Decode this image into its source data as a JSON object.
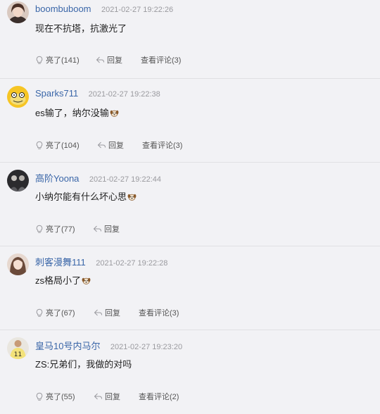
{
  "comments": [
    {
      "username": "boombuboom",
      "timestamp": "2021-02-27 19:22:26",
      "text": "现在不抗塔，抗激光了",
      "has_emoji": false,
      "like_label": "亮了(141)",
      "reply_label": "回复",
      "view_label": "查看评论(3)",
      "avatar_icon": "photo-avatar-woman-icon"
    },
    {
      "username": "Sparks711",
      "timestamp": "2021-02-27 19:22:38",
      "text": "es输了，纳尔没输",
      "has_emoji": true,
      "like_label": "亮了(104)",
      "reply_label": "回复",
      "view_label": "查看评论(3)",
      "avatar_icon": "yellow-cartoon-avatar-icon"
    },
    {
      "username": "高阶Yoona",
      "timestamp": "2021-02-27 19:22:44",
      "text": "小纳尔能有什么坏心思",
      "has_emoji": true,
      "like_label": "亮了(77)",
      "reply_label": "回复",
      "view_label": "",
      "avatar_icon": "dark-group-avatar-icon"
    },
    {
      "username": "刺客漫舞111",
      "timestamp": "2021-02-27 19:22:28",
      "text": "zs格局小了",
      "has_emoji": true,
      "like_label": "亮了(67)",
      "reply_label": "回复",
      "view_label": "查看评论(3)",
      "avatar_icon": "photo-avatar-girl-icon"
    },
    {
      "username": "皇马10号内马尔",
      "timestamp": "2021-02-27 19:23:20",
      "text": "ZS:兄弟们，我做的对吗",
      "has_emoji": false,
      "like_label": "亮了(55)",
      "reply_label": "回复",
      "view_label": "查看评论(2)",
      "avatar_icon": "jersey-player-avatar-icon"
    }
  ],
  "colors": {
    "background": "#f2f2f5",
    "username": "#3a66a8",
    "timestamp": "#9a9a9f",
    "action_text": "#555555",
    "divider": "#e0e0e3"
  }
}
